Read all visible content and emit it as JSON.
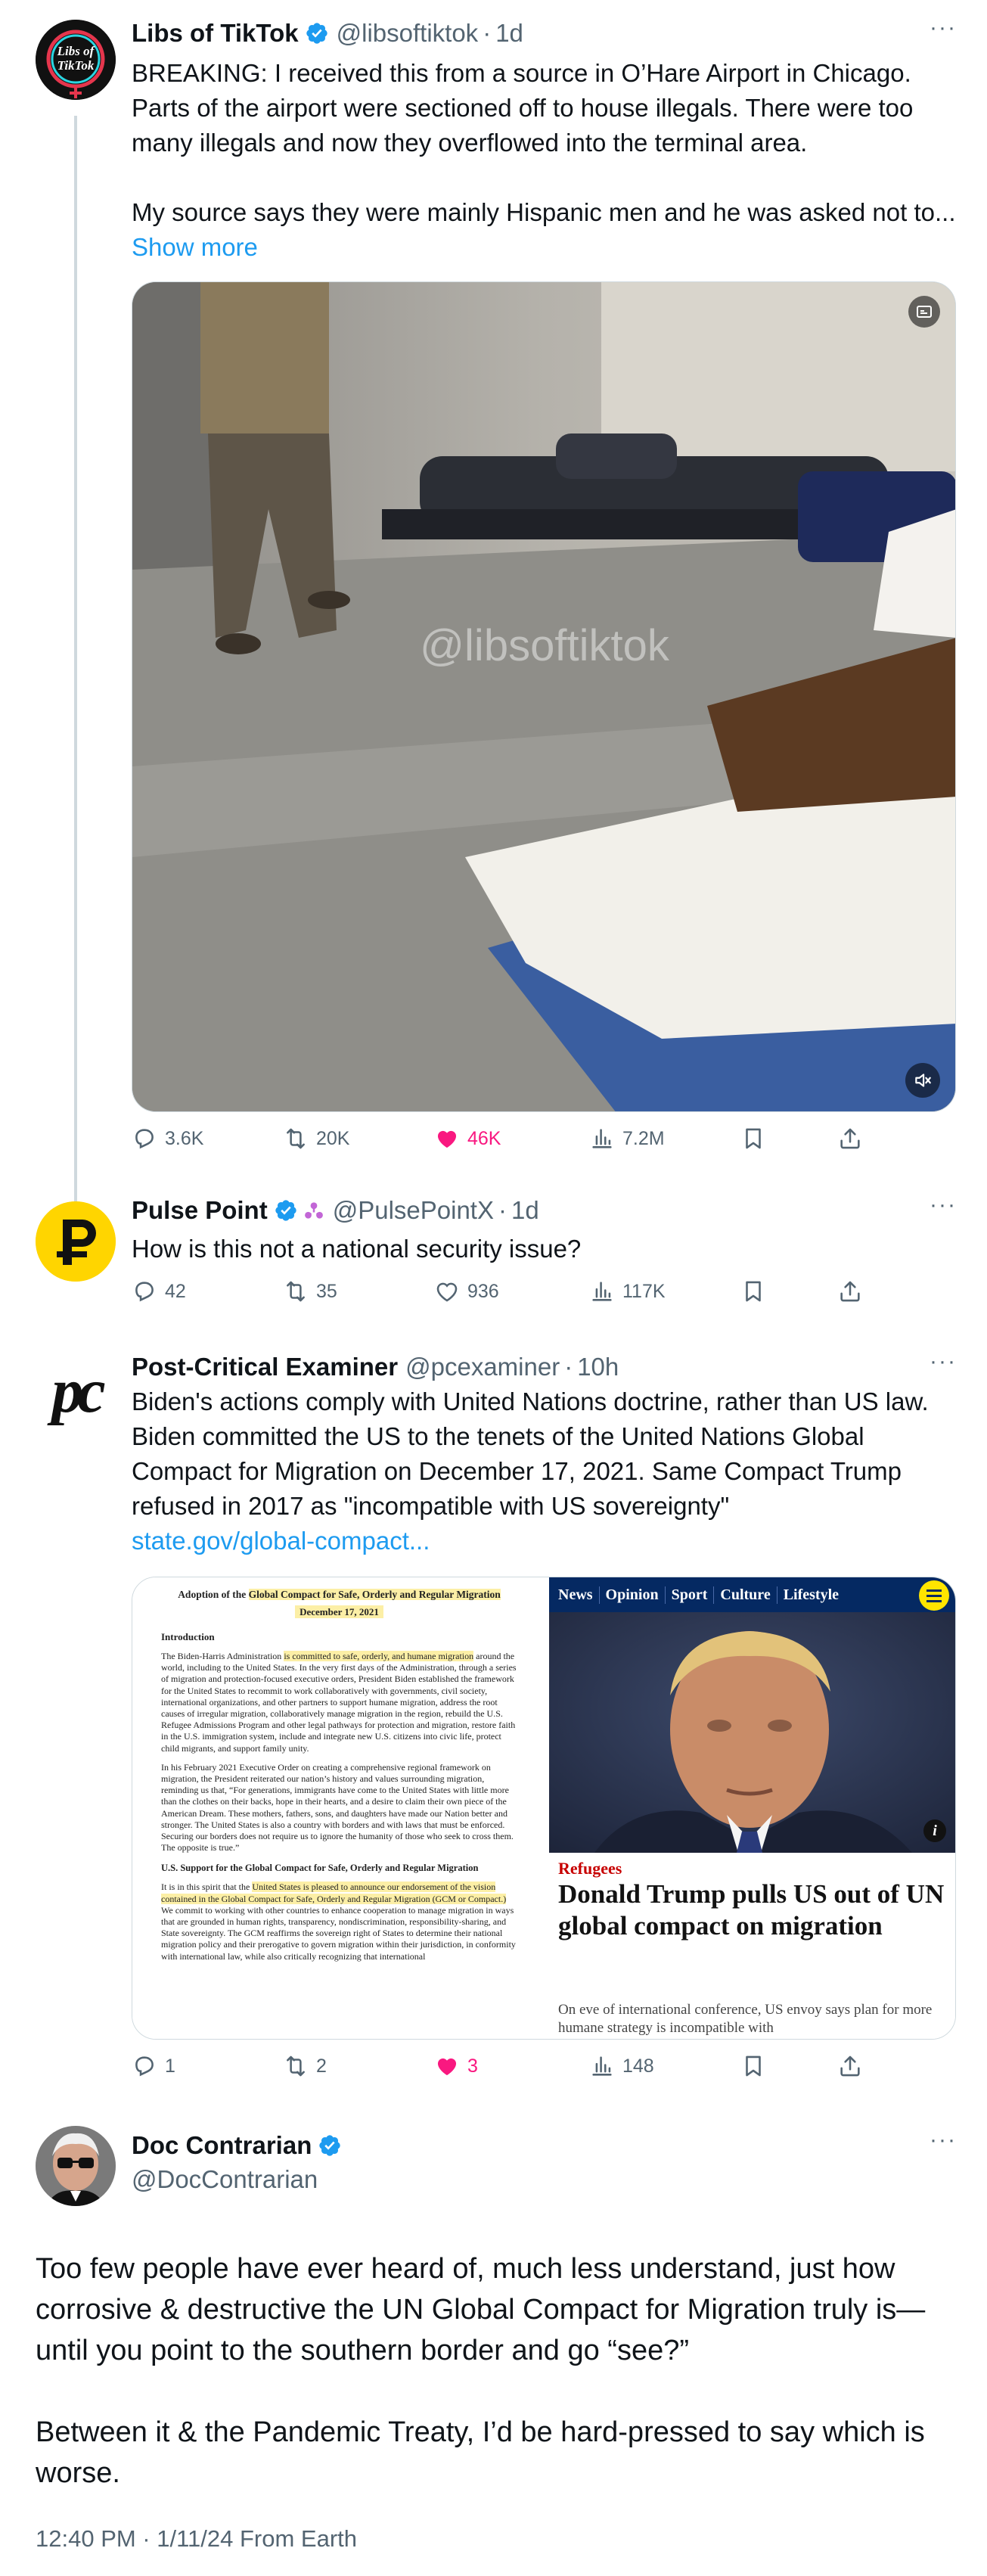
{
  "tweets": [
    {
      "name": "Libs of TikTok",
      "handle": "@libsoftiktok",
      "time": "1d",
      "text": "BREAKING: I received this from a source in O’Hare Airport in Chicago. Parts of the airport were sectioned off to house illegals. There were too many illegals and now they overflowed into the terminal area.\n\nMy source says they were mainly Hispanic men and he was asked not to... ",
      "show_more": "Show more",
      "avatar_text_1": "Libs of",
      "avatar_text_2": "TikTok",
      "video_watermark": "@libsoftiktok",
      "stats": {
        "replies": "3.6K",
        "reposts": "20K",
        "likes": "46K",
        "views": "7.2M"
      }
    },
    {
      "name": "Pulse Point",
      "handle": "@PulsePointX",
      "time": "1d",
      "text": "How is this not a national security issue?",
      "stats": {
        "replies": "42",
        "reposts": "35",
        "likes": "936",
        "views": "117K"
      }
    },
    {
      "name": "Post-Critical Examiner",
      "handle": "@pcexaminer",
      "time": "10h",
      "text": "Biden's actions comply with United Nations doctrine, rather than US law. Biden committed the US to the tenets of the United Nations Global Compact for Migration on December 17, 2021. Same Compact Trump refused in 2017 as \"incompatible with US sovereignty\"",
      "link": "state.gov/global-compact...",
      "avatar_text": "pc",
      "stats": {
        "replies": "1",
        "reposts": "2",
        "likes": "3",
        "views": "148"
      },
      "doc": {
        "title_pre": "Adoption of the ",
        "title_hl": "Global Compact for Safe, Orderly and Regular Migration",
        "date": "December 17, 2021",
        "intro_heading": "Introduction",
        "p1_pre": "The Biden-Harris Administration ",
        "p1_hl": "is committed to safe, orderly, and humane migration",
        "p1_post": " around the world, including to the United States. In the very first days of the Administration, through a series of migration and protection-focused executive orders, President Biden established the framework for the United States to recommit to work collaboratively with governments, civil society, international organizations, and other partners to support humane migration, address the root causes of irregular migration, collaboratively manage migration in the region, rebuild the U.S. Refugee Admissions Program and other legal pathways for protection and migration, restore faith in the U.S. immigration system, include and integrate new U.S. citizens into civic life, protect child migrants, and support family unity.",
        "p2": "In his February 2021 Executive Order on creating a comprehensive regional framework on migration, the President reiterated our nation’s history and values surrounding migration, reminding us that, “For generations, immigrants have come to the United States with little more than the clothes on their backs, hope in their hearts, and a desire to claim their own piece of the American Dream. These mothers, fathers, sons, and daughters have made our Nation better and stronger. The United States is also a country with borders and with laws that must be enforced. Securing our borders does not require us to ignore the humanity of those who seek to cross them. The opposite is true.”",
        "support_heading": "U.S. Support for the Global Compact for Safe, Orderly and Regular Migration",
        "p3_pre": "It is in this spirit that the ",
        "p3_hl": "United States is pleased to announce our endorsement of the vision contained in the Global Compact for Safe, Orderly and Regular Migration (GCM or Compact.)",
        "p3_post": " We commit to working with other countries to enhance cooperation to manage migration in ways that are grounded in human rights, transparency, nondiscrimination, responsibility-sharing, and State sovereignty. The GCM reaffirms the sovereign right of States to determine their national migration policy and their prerogative to govern migration within their jurisdiction, in conformity with international law, while also critically recognizing that international"
      },
      "news": {
        "nav": [
          "News",
          "Opinion",
          "Sport",
          "Culture",
          "Lifestyle"
        ],
        "kicker": "Refugees",
        "headline": "Donald Trump pulls US out of UN global compact on migration",
        "standfirst": "On eve of international conference, US envoy says plan for more humane strategy is incompatible with",
        "info": "i"
      }
    }
  ],
  "main": {
    "name": "Doc Contrarian",
    "handle": "@DocContrarian",
    "text": "Too few people have ever heard of, much less understand, just how corrosive & destructive the UN Global Compact for Migration truly is—until you point to the southern border and go “see?”\n\nBetween it & the Pandemic Treaty, I’d be hard-pressed to say which is worse.",
    "meta": "12:40 PM · 1/11/24 From Earth"
  },
  "colors": {
    "accent": "#1d9bf0",
    "like": "#f91880",
    "muted": "#536471",
    "thread_line": "#cfd9de",
    "pulse_yellow": "#ffd500",
    "guardian_blue": "#052962"
  },
  "icons": [
    "verified-badge-icon",
    "reply-icon",
    "repost-icon",
    "like-icon",
    "views-icon",
    "bookmark-icon",
    "share-icon",
    "more-icon",
    "mute-icon",
    "captions-icon",
    "menu-icon"
  ]
}
